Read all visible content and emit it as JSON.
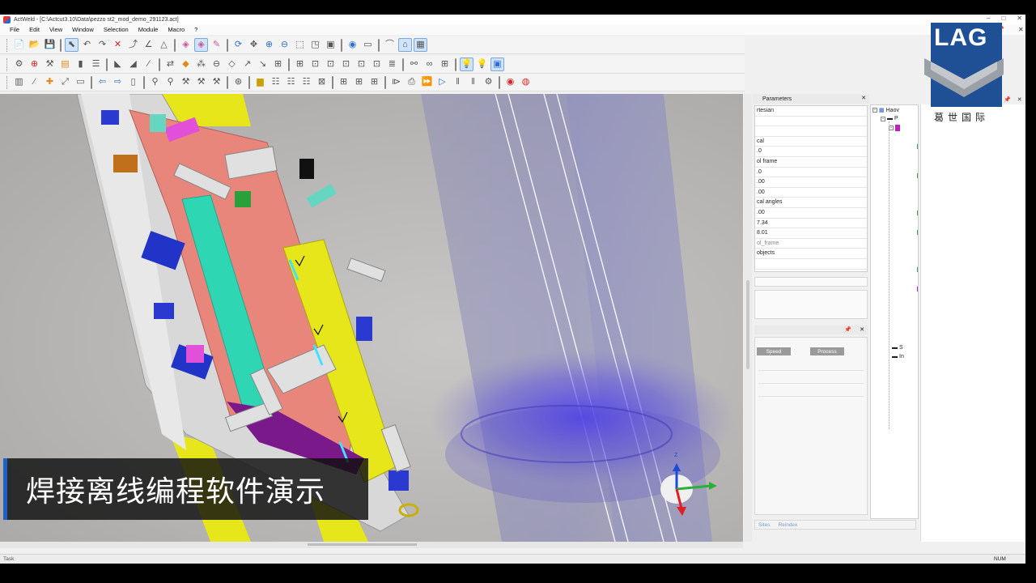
{
  "window": {
    "title": "ActWeld - [C:\\Actcut3.10\\Data\\pezzo st2_mod_demo_291123.act]",
    "controls": [
      "–",
      "□",
      "✕"
    ]
  },
  "menu": [
    "File",
    "Edit",
    "View",
    "Window",
    "Selection",
    "Module",
    "Macro",
    "?"
  ],
  "parameters_panel": {
    "title": "Parameters",
    "close": "✕",
    "rows": [
      {
        "text": "rtesian",
        "dim": false
      },
      {
        "text": "",
        "dim": false
      },
      {
        "text": "",
        "dim": false
      },
      {
        "text": "cal",
        "dim": false
      },
      {
        "text": ".0",
        "dim": false
      },
      {
        "text": "ol frame",
        "dim": false
      },
      {
        "text": ".0",
        "dim": false
      },
      {
        "text": ".00",
        "dim": false
      },
      {
        "text": ".00",
        "dim": false
      },
      {
        "text": "cal angles",
        "dim": false
      },
      {
        "text": ".00",
        "dim": false
      },
      {
        "text": "7.34",
        "dim": false
      },
      {
        "text": "8.01",
        "dim": false
      },
      {
        "text": "ol_frame",
        "dim": true
      },
      {
        "text": "objects",
        "dim": false
      },
      {
        "text": "",
        "dim": false
      },
      {
        "text": "",
        "dim": false
      }
    ],
    "sub_pin": "📌",
    "sub_close": "✕",
    "buttons": [
      "Speed",
      "Process"
    ],
    "bottom_links": [
      "Sites",
      "Reindex"
    ]
  },
  "tree": {
    "root": "Haov",
    "child": "P",
    "bottom_items": [
      "S",
      "In"
    ]
  },
  "logo": {
    "brand": "LAG",
    "chinese": "葛世国际",
    "pin": "📌",
    "close": "✕",
    "z_label": "Z"
  },
  "status": {
    "left": "Task",
    "right": "NUM"
  },
  "caption": "焊接离线编程软件演示",
  "axis_gizmo": {
    "z": "Z"
  },
  "colors": {
    "fixture_yellow": "#e6e61a",
    "plate_pink": "#e8867c",
    "channel_cyan": "#2fd6b4",
    "clamp_blue": "#2233c8",
    "accent_magenta": "#e24fd8",
    "caption_accent": "#1f60c7",
    "logo_blue": "#1f4f95"
  },
  "icons": {
    "toolbar1": [
      "folder-new-icon",
      "folder-open-icon",
      "save-icon",
      "select-arrow-icon",
      "undo-icon",
      "redo-icon",
      "delete-icon",
      "route-icon",
      "measure-icon",
      "triangle-icon",
      "eraser-pink-icon",
      "eraser-active-icon",
      "pencil-icon",
      "rotate-icon",
      "pan-icon",
      "zoom-in-icon",
      "zoom-out-icon",
      "zoom-window-icon",
      "view-cube-icon",
      "frame-icon",
      "fit-icon",
      "eye-icon",
      "camera-icon",
      "arc-icon",
      "home-view-icon",
      "grid-view-icon"
    ],
    "toolbar2": [
      "robot-icon",
      "target-icon",
      "weld-gun-icon",
      "tool-icon",
      "part-icon",
      "list-icon",
      "fixture-icon",
      "cut-icon",
      "draw-icon",
      "sync-icon",
      "path-icon",
      "seam-icon",
      "joint-icon",
      "weld-icon",
      "arrow-icon",
      "arrow-icon",
      "grid-icon",
      "grid-icon",
      "copy-icon",
      "copy-icon",
      "copy-icon",
      "copy-icon",
      "menu-icon",
      "network-icon",
      "network-icon",
      "network-icon",
      "bulb-icon",
      "bulb-note-icon",
      "bulb-screen-icon"
    ],
    "toolbar3": [
      "layers-icon",
      "edit-icon",
      "add-icon",
      "move-icon",
      "edit2-icon",
      "arrow-left-icon",
      "arrow-right-icon",
      "doc-icon",
      "robot2-icon",
      "robot3-icon",
      "tool2-icon",
      "tool3-icon",
      "tool4-icon",
      "crosshair-icon",
      "save2-icon",
      "list2-icon",
      "list3-icon",
      "list4-icon",
      "grid2-icon",
      "grid3-icon",
      "grid4-icon",
      "grid5-icon",
      "play-step-icon",
      "print-icon",
      "forward-icon",
      "play-icon",
      "pause-icon",
      "pause2-icon",
      "config-icon",
      "record-icon",
      "stop-record-icon"
    ]
  }
}
